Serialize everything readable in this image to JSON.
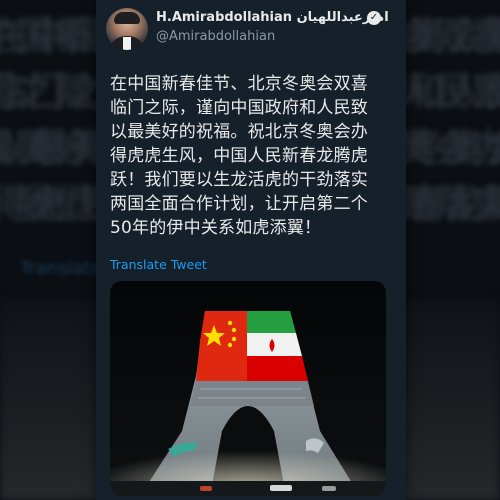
{
  "author": {
    "display_name": "H.Amirabdollahian امیرعبداللهیان",
    "handle": "@Amirabdollahian",
    "verified_icon": "verified-badge-icon"
  },
  "tweet": {
    "lines": [
      "在中国新春佳节、北京冬奥会双喜",
      "临门之际，谨向中国政府和人民致",
      "以最美好的祝福。祝北京冬奥会办",
      "得虎虎生风，中国人民新春龙腾虎",
      "跃！我们要以生龙活虎的干劲落实",
      "两国全面合作计划，让开启第二个",
      "50年的伊中关系如虎添翼！"
    ],
    "translate_label": "Translate Tweet"
  },
  "photo": {
    "description_icon": "azadi-tower-projection-image",
    "colors": {
      "iran_green": "#239f40",
      "iran_red": "#da0000",
      "china_red": "#de2910",
      "china_yellow": "#ffde00"
    }
  },
  "theme": {
    "card_bg": "#15202b",
    "text": "#e7e9ea",
    "muted": "#8b98a5",
    "link": "#1d9bf0"
  }
}
